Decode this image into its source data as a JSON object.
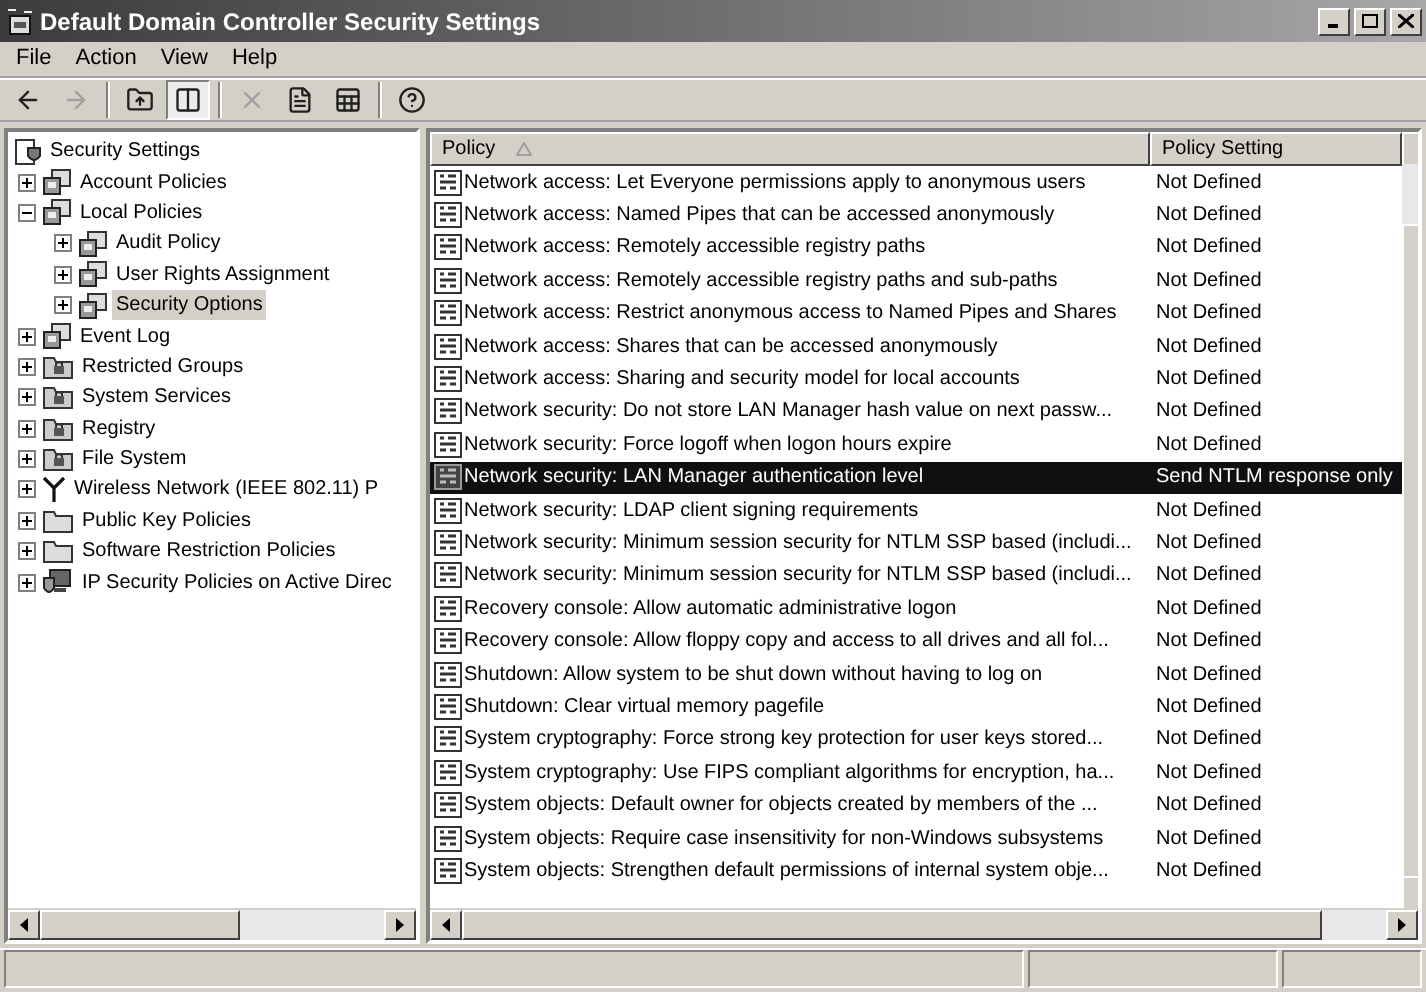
{
  "window": {
    "title": "Default Domain Controller Security Settings"
  },
  "menu": [
    "File",
    "Action",
    "View",
    "Help"
  ],
  "toolbar": [
    {
      "kind": "back",
      "disabled": false,
      "pressed": false
    },
    {
      "kind": "forward",
      "disabled": true,
      "pressed": false
    },
    {
      "kind": "separator"
    },
    {
      "kind": "up",
      "disabled": false,
      "pressed": false
    },
    {
      "kind": "tree",
      "disabled": false,
      "pressed": true
    },
    {
      "kind": "separator"
    },
    {
      "kind": "delete",
      "disabled": true,
      "pressed": false
    },
    {
      "kind": "properties",
      "disabled": false,
      "pressed": false
    },
    {
      "kind": "export",
      "disabled": false,
      "pressed": false
    },
    {
      "kind": "separator"
    },
    {
      "kind": "help",
      "disabled": false,
      "pressed": false
    }
  ],
  "tree": {
    "label": "Security Settings",
    "kind": "root",
    "selected": false,
    "children": [
      {
        "label": "Account Policies",
        "kind": "policy",
        "expanded": false,
        "selected": false
      },
      {
        "label": "Local Policies",
        "kind": "policy",
        "expanded": true,
        "selected": false,
        "children": [
          {
            "label": "Audit Policy",
            "kind": "policy",
            "expanded": false,
            "selected": false
          },
          {
            "label": "User Rights Assignment",
            "kind": "policy",
            "expanded": false,
            "selected": false
          },
          {
            "label": "Security Options",
            "kind": "policy",
            "expanded": false,
            "selected": true
          }
        ]
      },
      {
        "label": "Event Log",
        "kind": "policy",
        "expanded": false,
        "selected": false
      },
      {
        "label": "Restricted Groups",
        "kind": "lockfolder",
        "expanded": false,
        "selected": false
      },
      {
        "label": "System Services",
        "kind": "lockfolder",
        "expanded": false,
        "selected": false
      },
      {
        "label": "Registry",
        "kind": "lockfolder",
        "expanded": false,
        "selected": false
      },
      {
        "label": "File System",
        "kind": "lockfolder",
        "expanded": false,
        "selected": false
      },
      {
        "label": "Wireless Network (IEEE 802.11) P",
        "kind": "antenna",
        "expanded": false,
        "selected": false
      },
      {
        "label": "Public Key Policies",
        "kind": "folder",
        "expanded": false,
        "selected": false
      },
      {
        "label": "Software Restriction Policies",
        "kind": "folder",
        "expanded": false,
        "selected": false
      },
      {
        "label": "IP Security Policies on Active Direc",
        "kind": "network",
        "expanded": false,
        "selected": false
      }
    ]
  },
  "table": {
    "columns": [
      "Policy",
      "Policy Setting"
    ],
    "rows": [
      {
        "policy": "Network access: Let Everyone permissions apply to anonymous users",
        "setting": "Not Defined",
        "selected": false
      },
      {
        "policy": "Network access: Named Pipes that can be accessed anonymously",
        "setting": "Not Defined",
        "selected": false
      },
      {
        "policy": "Network access: Remotely accessible registry paths",
        "setting": "Not Defined",
        "selected": false
      },
      {
        "policy": "Network access: Remotely accessible registry paths and sub-paths",
        "setting": "Not Defined",
        "selected": false
      },
      {
        "policy": "Network access: Restrict anonymous access to Named Pipes and Shares",
        "setting": "Not Defined",
        "selected": false
      },
      {
        "policy": "Network access: Shares that can be accessed anonymously",
        "setting": "Not Defined",
        "selected": false
      },
      {
        "policy": "Network access: Sharing and security model for local accounts",
        "setting": "Not Defined",
        "selected": false
      },
      {
        "policy": "Network security: Do not store LAN Manager hash value on next passw...",
        "setting": "Not Defined",
        "selected": false
      },
      {
        "policy": "Network security: Force logoff when logon hours expire",
        "setting": "Not Defined",
        "selected": false
      },
      {
        "policy": "Network security: LAN Manager authentication level",
        "setting": "Send NTLM response only",
        "selected": true
      },
      {
        "policy": "Network security: LDAP client signing requirements",
        "setting": "Not Defined",
        "selected": false
      },
      {
        "policy": "Network security: Minimum session security for NTLM SSP based (includi...",
        "setting": "Not Defined",
        "selected": false
      },
      {
        "policy": "Network security: Minimum session security for NTLM SSP based (includi...",
        "setting": "Not Defined",
        "selected": false
      },
      {
        "policy": "Recovery console: Allow automatic administrative logon",
        "setting": "Not Defined",
        "selected": false
      },
      {
        "policy": "Recovery console: Allow floppy copy and access to all drives and all fol...",
        "setting": "Not Defined",
        "selected": false
      },
      {
        "policy": "Shutdown: Allow system to be shut down without having to log on",
        "setting": "Not Defined",
        "selected": false
      },
      {
        "policy": "Shutdown: Clear virtual memory pagefile",
        "setting": "Not Defined",
        "selected": false
      },
      {
        "policy": "System cryptography: Force strong key protection for user keys stored...",
        "setting": "Not Defined",
        "selected": false
      },
      {
        "policy": "System cryptography: Use FIPS compliant algorithms for encryption, ha...",
        "setting": "Not Defined",
        "selected": false
      },
      {
        "policy": "System objects: Default owner for objects created by members of the ...",
        "setting": "Not Defined",
        "selected": false
      },
      {
        "policy": "System objects: Require case insensitivity for non-Windows subsystems",
        "setting": "Not Defined",
        "selected": false
      },
      {
        "policy": "System objects: Strengthen default permissions of internal system obje...",
        "setting": "Not Defined",
        "selected": false
      }
    ]
  }
}
